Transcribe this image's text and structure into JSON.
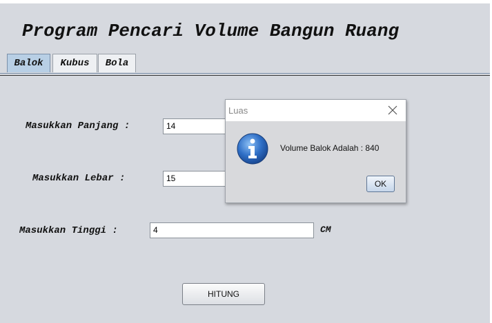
{
  "app": {
    "title": "Program Pencari Volume Bangun Ruang"
  },
  "tabs": [
    {
      "label": "Balok",
      "active": true
    },
    {
      "label": "Kubus",
      "active": false
    },
    {
      "label": "Bola",
      "active": false
    }
  ],
  "form": {
    "panjang": {
      "label": "Masukkan Panjang :",
      "value": "14"
    },
    "lebar": {
      "label": "Masukkan Lebar :",
      "value": "15"
    },
    "tinggi": {
      "label": "Masukkan Tinggi :",
      "value": "4",
      "unit": "CM"
    },
    "submit_label": "HITUNG"
  },
  "dialog": {
    "title": "Luas",
    "message": "Volume Balok Adalah : 840",
    "ok_label": "OK",
    "icon": "info-icon"
  },
  "colors": {
    "background": "#d6d9df",
    "active_tab": "#b8cfe5",
    "info_icon": "#2f6fc6"
  }
}
